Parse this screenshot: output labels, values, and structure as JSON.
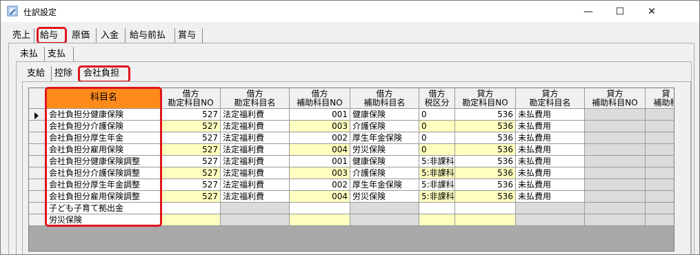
{
  "window": {
    "title": "仕訳設定",
    "icon": "edit-document-icon",
    "minimize": "—",
    "maximize": "☐",
    "close": "✕"
  },
  "tabs_level1": [
    "売上",
    "給与",
    "原価",
    "入金",
    "給与前払",
    "賞与"
  ],
  "tabs_level2": [
    "未払",
    "支払"
  ],
  "tabs_level3": [
    "支給",
    "控除",
    "会社負担"
  ],
  "grid": {
    "headers": [
      [
        "科目名"
      ],
      [
        "借方",
        "勘定科目NO"
      ],
      [
        "借方",
        "勘定科目名"
      ],
      [
        "借方",
        "補助科目NO"
      ],
      [
        "借方",
        "補助科目名"
      ],
      [
        "借方",
        "税区分"
      ],
      [
        "貸方",
        "勘定科目NO"
      ],
      [
        "貸方",
        "勘定科目名"
      ],
      [
        "貸方",
        "補助科目NO"
      ],
      [
        "貸",
        "補助科"
      ]
    ],
    "rows": [
      [
        "会社負担分健康保険",
        "527",
        "法定福利費",
        "001",
        "健康保険",
        "0",
        "536",
        "未払費用",
        "",
        ""
      ],
      [
        "会社負担分介護保険",
        "527",
        "法定福利費",
        "003",
        "介護保険",
        "0",
        "536",
        "未払費用",
        "",
        ""
      ],
      [
        "会社負担分厚生年金",
        "527",
        "法定福利費",
        "002",
        "厚生年金保険",
        "0",
        "536",
        "未払費用",
        "",
        ""
      ],
      [
        "会社負担分雇用保険",
        "527",
        "法定福利費",
        "004",
        "労災保険",
        "0",
        "536",
        "未払費用",
        "",
        ""
      ],
      [
        "会社負担分健康保険調整",
        "527",
        "法定福利費",
        "001",
        "健康保険",
        "5:非課科",
        "536",
        "未払費用",
        "",
        ""
      ],
      [
        "会社負担分介護保険調整",
        "527",
        "法定福利費",
        "003",
        "介護保険",
        "5:非課科",
        "536",
        "未払費用",
        "",
        ""
      ],
      [
        "会社負担分厚生年金調整",
        "527",
        "法定福利費",
        "002",
        "厚生年金保険",
        "5:非課科",
        "536",
        "未払費用",
        "",
        ""
      ],
      [
        "会社負担分雇用保険調整",
        "527",
        "法定福利費",
        "004",
        "労災保険",
        "5:非課科",
        "536",
        "未払費用",
        "",
        ""
      ],
      [
        "子ども子育て拠出金",
        "",
        "",
        "",
        "",
        "",
        "",
        "",
        "",
        ""
      ],
      [
        "労災保険",
        "",
        "",
        "",
        "",
        "",
        "",
        "",
        "",
        ""
      ]
    ]
  }
}
